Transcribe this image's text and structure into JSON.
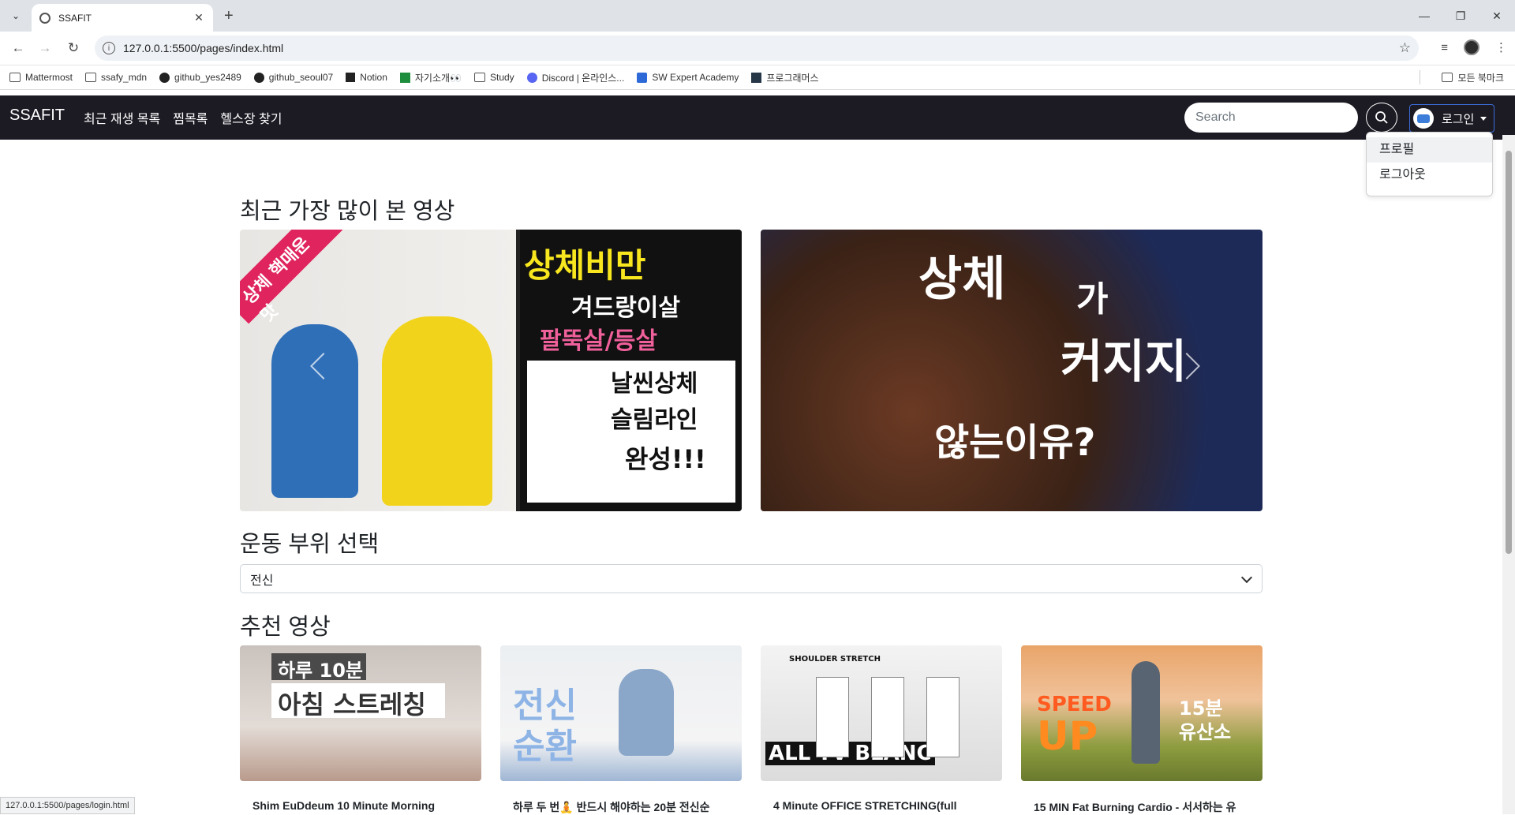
{
  "browser": {
    "tab_title": "SSAFIT",
    "url": "127.0.0.1:5500/pages/index.html",
    "status_url": "127.0.0.1:5500/pages/login.html",
    "bookmarks": [
      "Mattermost",
      "ssafy_mdn",
      "github_yes2489",
      "github_seoul07",
      "Notion",
      "자기소개👀",
      "Study",
      "Discord | 온라인스...",
      "SW Expert Academy",
      "프로그래머스"
    ],
    "all_bookmarks": "모든 북마크"
  },
  "navbar": {
    "brand": "SSAFIT",
    "links": [
      "최근 재생 목록",
      "찜목록",
      "헬스장 찾기"
    ],
    "search_placeholder": "Search",
    "login_label": "로그인",
    "dropdown": [
      "프로필",
      "로그아웃"
    ]
  },
  "sections": {
    "most_viewed": "최근 가장 많이 본 영상",
    "part_select": "운동 부위 선택",
    "recommended": "추천 영상"
  },
  "part_select_value": "전신",
  "carousel": [
    {
      "lines": [
        "상체비만",
        "겨드랑이살",
        "팔뚝살/등살",
        "날씬상체",
        "슬림라인",
        "완성!!!"
      ],
      "corner": "상체 핵매운맛"
    },
    {
      "lines": [
        "상체",
        "가",
        "커지지",
        "않는이유?"
      ]
    }
  ],
  "videos": [
    {
      "title": "Shim EuDdeum 10 Minute Morning",
      "thumb_lines": [
        "하루 10분",
        "아침 스트레칭"
      ]
    },
    {
      "title": "하루 두 번🧘 반드시 해야하는 20분 전신순",
      "thumb_lines": [
        "전신",
        "순환"
      ]
    },
    {
      "title": "4 Minute OFFICE STRETCHING(full",
      "thumb_lines": [
        "SHOULDER STRETCH",
        "ALL TV BLANC"
      ]
    },
    {
      "title": "15 MIN Fat Burning Cardio - 서서하는 유",
      "thumb_lines": [
        "SPEED",
        "UP",
        "15분",
        "유산소"
      ]
    }
  ]
}
